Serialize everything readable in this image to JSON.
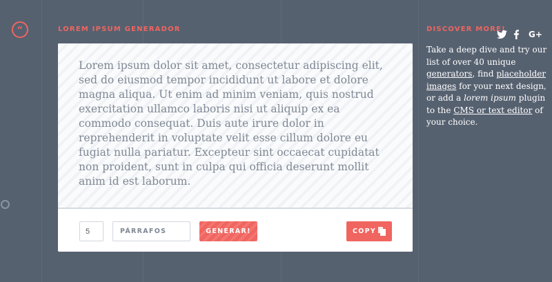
{
  "brand": {
    "logo_glyph": "“",
    "color": "#f0655f"
  },
  "generator": {
    "title": "LOREM IPSUM GENERADOR",
    "text": "Lorem ipsum dolor sit amet, consectetur adipiscing elit, sed do eiusmod tempor incididunt ut labore et dolore magna aliqua. Ut enim ad minim veniam, quis nostrud exercitation ullamco laboris nisi ut aliquip ex ea commodo consequat. Duis aute irure dolor in reprehenderit in voluptate velit esse cillum dolore eu fugiat nulla pariatur. Excepteur sint occaecat cupidatat non proident, sunt in culpa qui officia deserunt mollit anim id est laborum."
  },
  "controls": {
    "count_value": "5",
    "unit_selected": "PÁRRAFOS",
    "generate_label": "GENERAR!",
    "copy_label": "COPY"
  },
  "sidebar": {
    "title": "DISCOVER MORE!",
    "social_icons": [
      "twitter-icon",
      "facebook-icon",
      "google-plus-icon"
    ],
    "text_1": "Take a deep dive and try our list of over 40 unique ",
    "link_generators": "generators",
    "text_2": ", find ",
    "link_images": "placeholder images",
    "text_3": " for your next design, or add a ",
    "em_lorem": "lorem ipsum",
    "text_4": " plugin to the ",
    "link_cms": "CMS or text editor",
    "text_5": " of your choice."
  },
  "colors": {
    "background": "#566170",
    "accent": "#f0655f",
    "card": "#ffffff",
    "text_muted": "#7f8895"
  }
}
